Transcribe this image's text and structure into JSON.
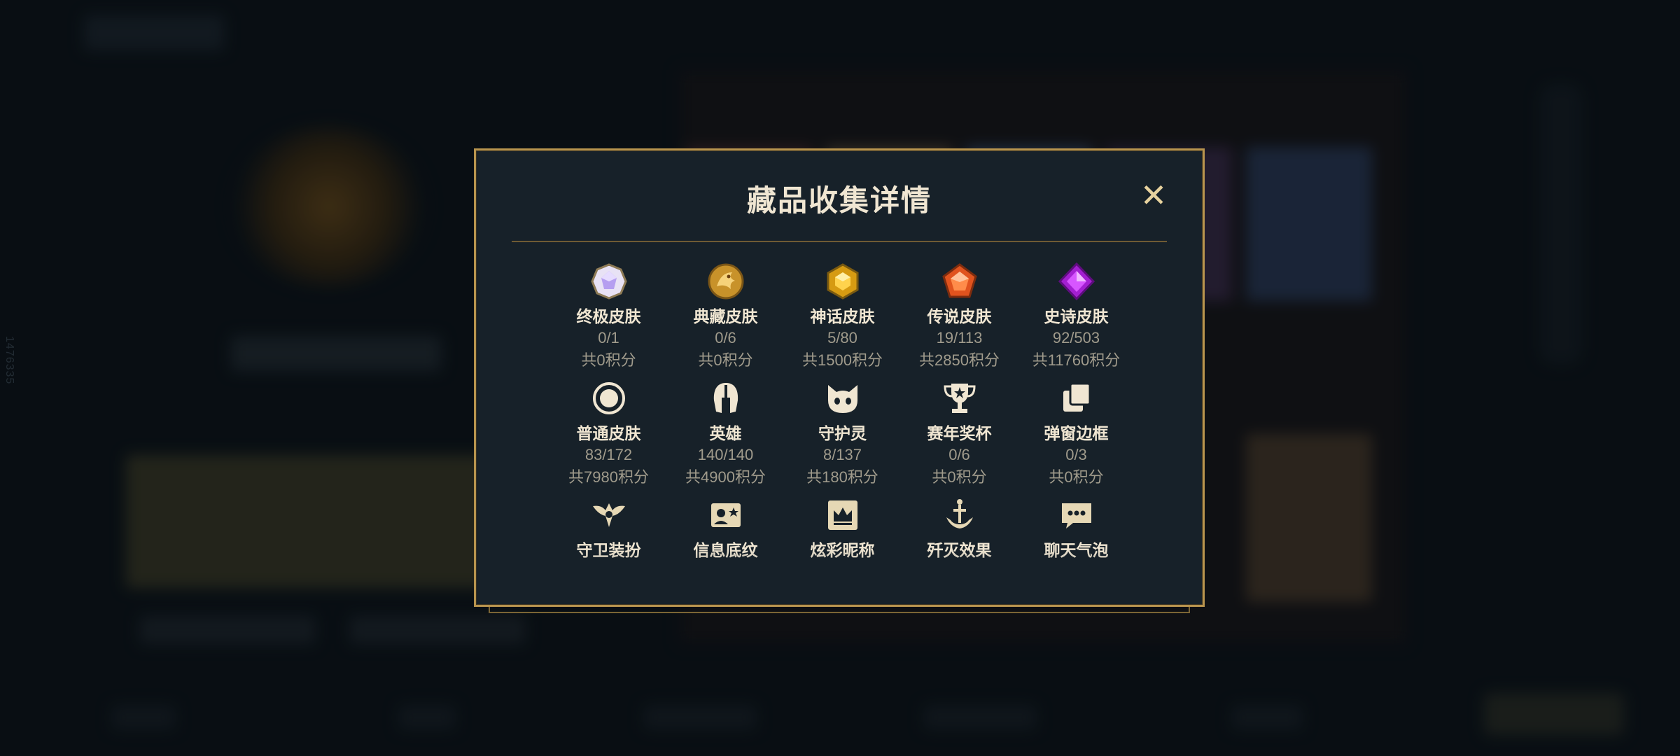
{
  "background": {
    "side_text": "1476335"
  },
  "modal": {
    "title": "藏品收集详情",
    "close_symbol": "✕"
  },
  "items": [
    {
      "label": "终极皮肤",
      "count": "0/1",
      "points": "共0积分",
      "icon": "ultimate-gem-icon"
    },
    {
      "label": "典藏皮肤",
      "count": "0/6",
      "points": "共0积分",
      "icon": "dragon-emblem-icon"
    },
    {
      "label": "神话皮肤",
      "count": "5/80",
      "points": "共1500积分",
      "icon": "mythic-gem-icon"
    },
    {
      "label": "传说皮肤",
      "count": "19/113",
      "points": "共2850积分",
      "icon": "legendary-gem-icon"
    },
    {
      "label": "史诗皮肤",
      "count": "92/503",
      "points": "共11760积分",
      "icon": "epic-gem-icon"
    },
    {
      "label": "普通皮肤",
      "count": "83/172",
      "points": "共7980积分",
      "icon": "ring-icon"
    },
    {
      "label": "英雄",
      "count": "140/140",
      "points": "共4900积分",
      "icon": "helmet-icon"
    },
    {
      "label": "守护灵",
      "count": "8/137",
      "points": "共180积分",
      "icon": "guardian-pet-icon"
    },
    {
      "label": "赛年奖杯",
      "count": "0/6",
      "points": "共0积分",
      "icon": "trophy-icon"
    },
    {
      "label": "弹窗边框",
      "count": "0/3",
      "points": "共0积分",
      "icon": "frames-icon"
    },
    {
      "label": "守卫装扮",
      "icon": "ward-icon"
    },
    {
      "label": "信息底纹",
      "icon": "card-banner-icon"
    },
    {
      "label": "炫彩昵称",
      "icon": "crown-card-icon"
    },
    {
      "label": "歼灭效果",
      "icon": "sword-icon"
    },
    {
      "label": "聊天气泡",
      "icon": "chat-bubble-icon"
    }
  ]
}
